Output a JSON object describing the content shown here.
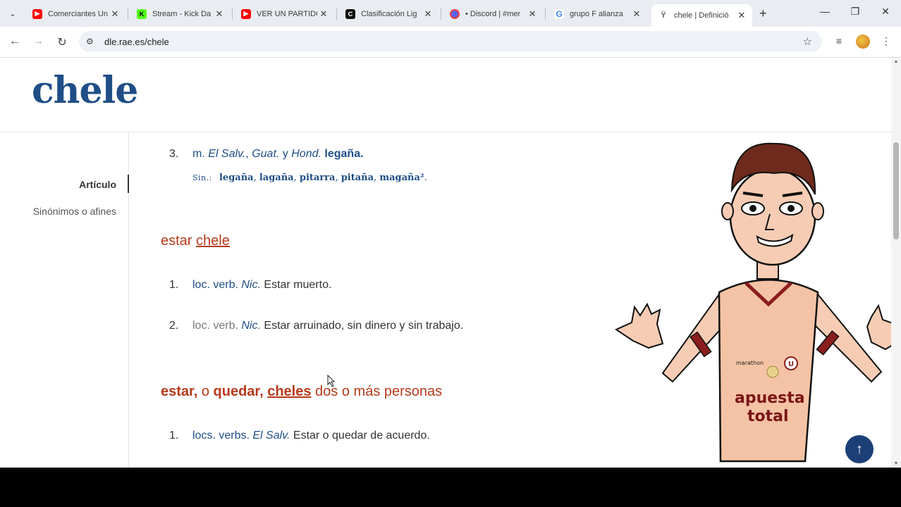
{
  "browser": {
    "tabs": [
      {
        "label": "Comerciantes Un",
        "icon": "youtube-icon",
        "color": "#ff0000"
      },
      {
        "label": "Stream - Kick Da",
        "icon": "kick-icon",
        "color": "#53fc18"
      },
      {
        "label": "VER UN PARTIDO",
        "icon": "youtube-icon",
        "color": "#ff0000"
      },
      {
        "label": "Clasificación Lig",
        "icon": "c-icon",
        "color": "#111111"
      },
      {
        "label": "• Discord | #mer",
        "icon": "discord-icon",
        "color": "#ff3b3b"
      },
      {
        "label": "grupo F alianza",
        "icon": "google-icon",
        "color": "#4285f4"
      },
      {
        "label": "chele | Definició",
        "icon": "rae-icon",
        "color": "#555555",
        "active": true
      }
    ],
    "new_tab": "+",
    "url": "dle.rae.es/chele",
    "window_controls": {
      "minimize": "—",
      "maximize": "❐",
      "close": "✕"
    }
  },
  "page": {
    "headword": "chele",
    "sidebar": {
      "items": [
        {
          "label": "Artículo",
          "active": true
        },
        {
          "label": "Sinónimos o afines",
          "active": false
        }
      ]
    },
    "sense3": {
      "num": "3.",
      "m": "m.",
      "region1": "El Salv.",
      "sep1": ",",
      "region2": "Guat.",
      "y": "y",
      "region3": "Hond.",
      "def": "legaña."
    },
    "synonyms": {
      "label": "Sin.:",
      "words": [
        "legaña",
        "lagaña",
        "pitarra",
        "pitaña",
        "magaña²"
      ]
    },
    "locution1": {
      "pre": "estar",
      "link": "chele",
      "senses": [
        {
          "num": "1.",
          "abbr": "loc. verb.",
          "region": "Nic.",
          "def": "Estar muerto."
        },
        {
          "num": "2.",
          "abbr": "loc. verb.",
          "region": "Nic.",
          "def": "Estar arruinado, sin dinero y sin trabajo."
        }
      ]
    },
    "locution2": {
      "p1": "estar,",
      "p2": "o",
      "p3": "quedar,",
      "link": "cheles",
      "rest": "dos o más personas",
      "senses": [
        {
          "num": "1.",
          "abbr": "locs. verbs.",
          "region": "El Salv.",
          "def": "Estar o quedar de acuerdo."
        }
      ]
    },
    "cartoon": {
      "shirt_brand": "marathon",
      "shirt_text_1": "apuesta",
      "shirt_text_2": "total",
      "crest": "U"
    },
    "back_to_top": "↑"
  }
}
